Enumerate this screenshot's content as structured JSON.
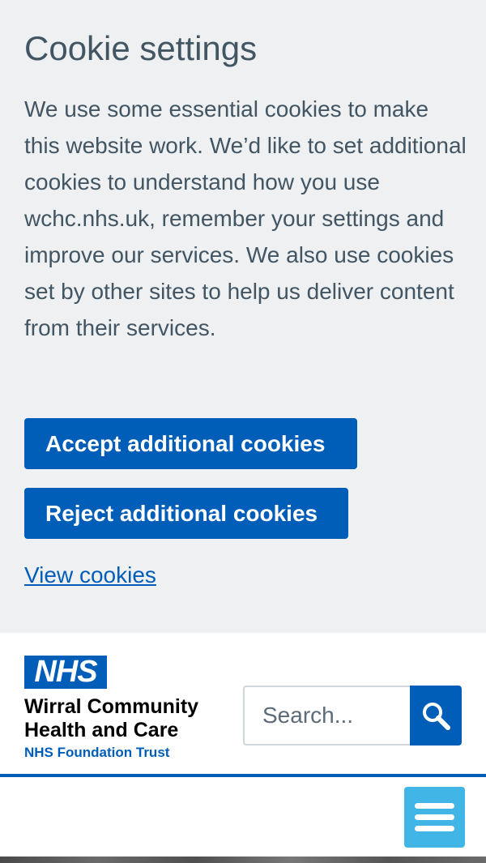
{
  "cookie_banner": {
    "title": "Cookie settings",
    "text": "We use some essential cookies to make this website work. We’d like to set additional cookies to understand how you use wchc.nhs.uk, remember your settings and improve our services. We also use cookies set by other sites to help us deliver content from their services.",
    "accept_label": "Accept additional cookies",
    "reject_label": "Reject additional cookies",
    "view_link": "View cookies"
  },
  "header": {
    "logo_text": "NHS",
    "org_name_line1": "Wirral Community",
    "org_name_line2": "Health and Care",
    "org_sub": "NHS Foundation Trust",
    "search_placeholder": "Search...",
    "search_icon": "search-icon",
    "menu_icon": "hamburger-menu-icon"
  },
  "colors": {
    "nhs_blue": "#005eb8",
    "banner_bg": "#eef0f2",
    "text": "#425563",
    "menu_button": "#41b6e6"
  }
}
